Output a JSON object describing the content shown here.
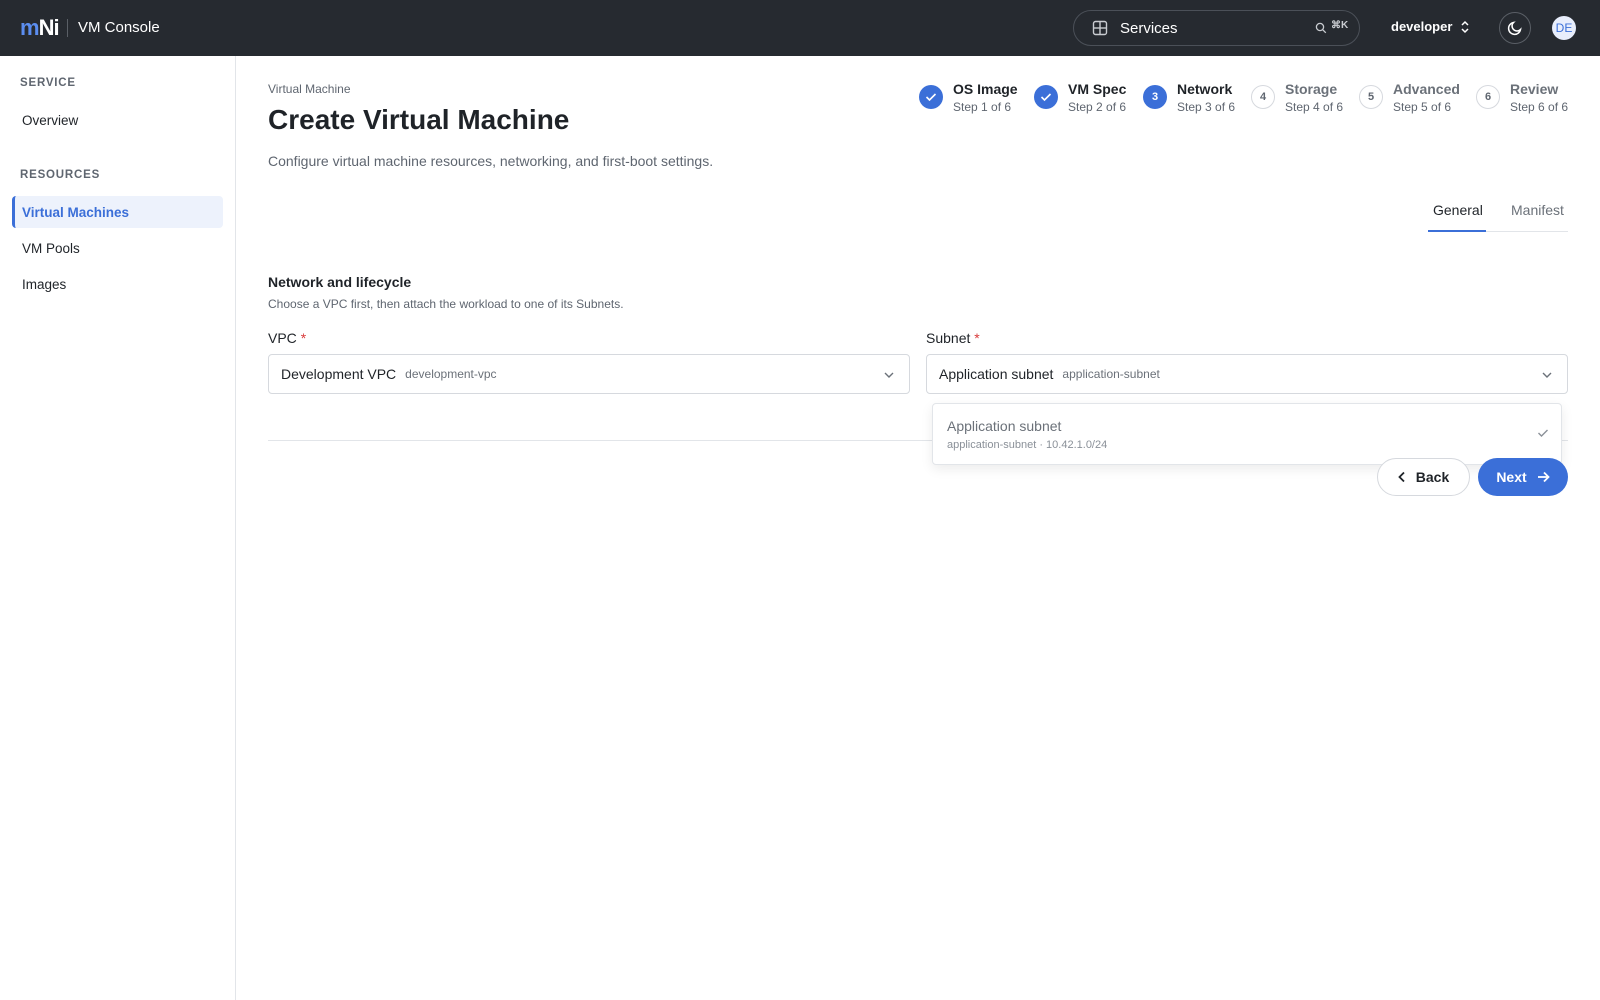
{
  "topbar": {
    "logo_m": "m",
    "logo_ni": "Ni",
    "app_title": "VM Console",
    "search_label": "Services",
    "search_shortcut": "⌘K",
    "user": "developer",
    "avatar_initials": "DE"
  },
  "sidebar": {
    "service_label": "SERVICE",
    "resources_label": "RESOURCES",
    "items": [
      {
        "label": "Overview"
      },
      {
        "label": "Virtual Machines"
      },
      {
        "label": "VM Pools"
      },
      {
        "label": "Images"
      }
    ]
  },
  "page": {
    "breadcrumb": "Virtual Machine",
    "title": "Create Virtual Machine",
    "description": "Configure virtual machine resources, networking, and first-boot settings."
  },
  "stepper": [
    {
      "name": "OS Image",
      "sub": "Step 1 of 6",
      "state": "done"
    },
    {
      "name": "VM Spec",
      "sub": "Step 2 of 6",
      "state": "done"
    },
    {
      "name": "Network",
      "sub": "Step 3 of 6",
      "state": "current",
      "number": "3"
    },
    {
      "name": "Storage",
      "sub": "Step 4 of 6",
      "state": "todo",
      "number": "4"
    },
    {
      "name": "Advanced",
      "sub": "Step 5 of 6",
      "state": "todo",
      "number": "5"
    },
    {
      "name": "Review",
      "sub": "Step 6 of 6",
      "state": "todo",
      "number": "6"
    }
  ],
  "tabs": [
    {
      "label": "General",
      "active": true
    },
    {
      "label": "Manifest",
      "active": false
    }
  ],
  "section": {
    "title": "Network and lifecycle",
    "description": "Choose a VPC first, then attach the workload to one of its Subnets."
  },
  "vpc": {
    "label": "VPC",
    "required_mark": "*",
    "value": "Development VPC",
    "value_sub": "development-vpc"
  },
  "subnet": {
    "label": "Subnet",
    "required_mark": "*",
    "value": "Application subnet",
    "value_sub": "application-subnet",
    "options": [
      {
        "title": "Application subnet",
        "sub": "application-subnet · 10.42.1.0/24",
        "selected": true
      }
    ]
  },
  "actions": {
    "back_label": "Back",
    "next_label": "Next"
  },
  "colors": {
    "accent": "#3b6fd8",
    "topbar": "#262a30",
    "required": "#d93b3b"
  }
}
